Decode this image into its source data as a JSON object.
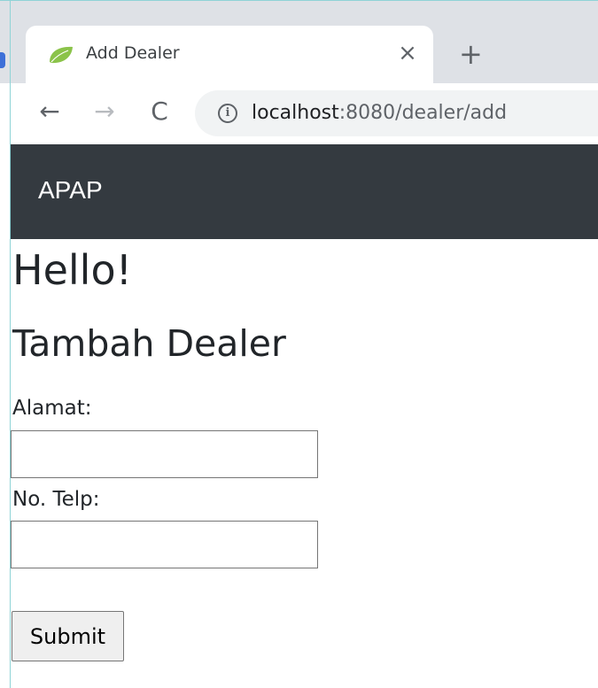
{
  "browser": {
    "tab": {
      "title": "Add Dealer",
      "favicon": "spring-leaf-icon",
      "close_glyph": "×"
    },
    "new_tab_glyph": "+",
    "nav": {
      "back_glyph": "←",
      "forward_glyph": "→",
      "reload_glyph": "C"
    },
    "address": {
      "host": "localhost",
      "rest": ":8080/dealer/add",
      "info_glyph": "i"
    }
  },
  "navbar": {
    "brand": "APAP",
    "background": "#343a40"
  },
  "page": {
    "greeting": "Hello!",
    "form_title": "Tambah Dealer",
    "form": {
      "alamat_label": "Alamat:",
      "alamat_value": "",
      "telp_label": "No. Telp:",
      "telp_value": "",
      "submit_label": "Submit"
    }
  }
}
